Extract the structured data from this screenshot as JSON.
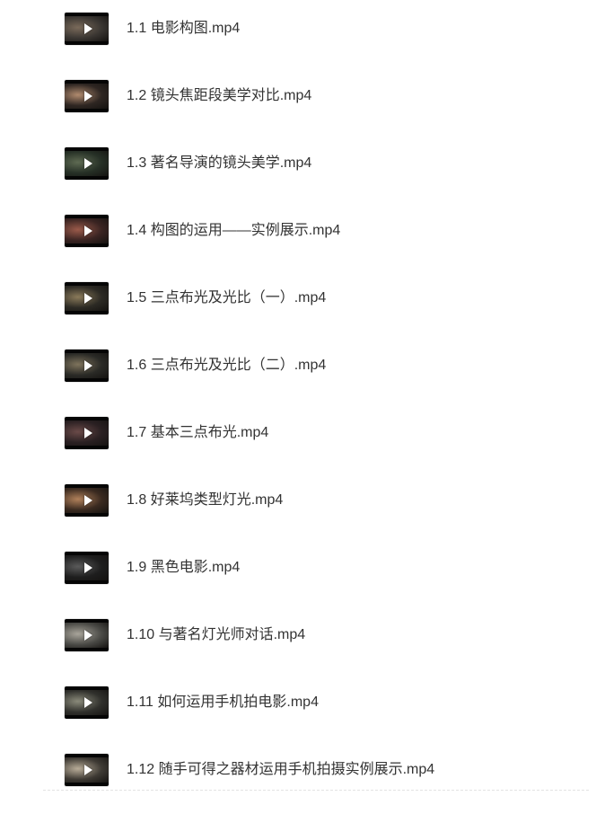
{
  "files": [
    {
      "name": "1.1 电影构图.mp4",
      "thumbnail_tone": "#3a3632",
      "thumbnail_accent": "#7a6a5a"
    },
    {
      "name": "1.2 镜头焦距段美学对比.mp4",
      "thumbnail_tone": "#2e2622",
      "thumbnail_accent": "#b08a6e"
    },
    {
      "name": "1.3 著名导演的镜头美学.mp4",
      "thumbnail_tone": "#263026",
      "thumbnail_accent": "#5e6a52"
    },
    {
      "name": "1.4 构图的运用——实例展示.mp4",
      "thumbnail_tone": "#3a2422",
      "thumbnail_accent": "#9a5a4a"
    },
    {
      "name": "1.5 三点布光及光比（一）.mp4",
      "thumbnail_tone": "#2c2a24",
      "thumbnail_accent": "#8a7a5a"
    },
    {
      "name": "1.6 三点布光及光比（二）.mp4",
      "thumbnail_tone": "#2a2a26",
      "thumbnail_accent": "#7e735c"
    },
    {
      "name": "1.7 基本三点布光.mp4",
      "thumbnail_tone": "#2a2022",
      "thumbnail_accent": "#6a4a48"
    },
    {
      "name": "1.8 好莱坞类型灯光.mp4",
      "thumbnail_tone": "#3a2a20",
      "thumbnail_accent": "#b0805a"
    },
    {
      "name": "1.9 黑色电影.mp4",
      "thumbnail_tone": "#1e1e1e",
      "thumbnail_accent": "#5a5a5a"
    },
    {
      "name": "1.10 与著名灯光师对话.mp4",
      "thumbnail_tone": "#4a4a46",
      "thumbnail_accent": "#a8a49a"
    },
    {
      "name": "1.11 如何运用手机拍电影.mp4",
      "thumbnail_tone": "#30302c",
      "thumbnail_accent": "#8a8a7a"
    },
    {
      "name": "1.12 随手可得之器材运用手机拍摄实例展示.mp4",
      "thumbnail_tone": "#3e3a34",
      "thumbnail_accent": "#b8ac98"
    }
  ],
  "icons": {
    "row_thumbnail_overlay": "play-icon"
  },
  "colors": {
    "text": "#333333",
    "background": "#ffffff"
  }
}
